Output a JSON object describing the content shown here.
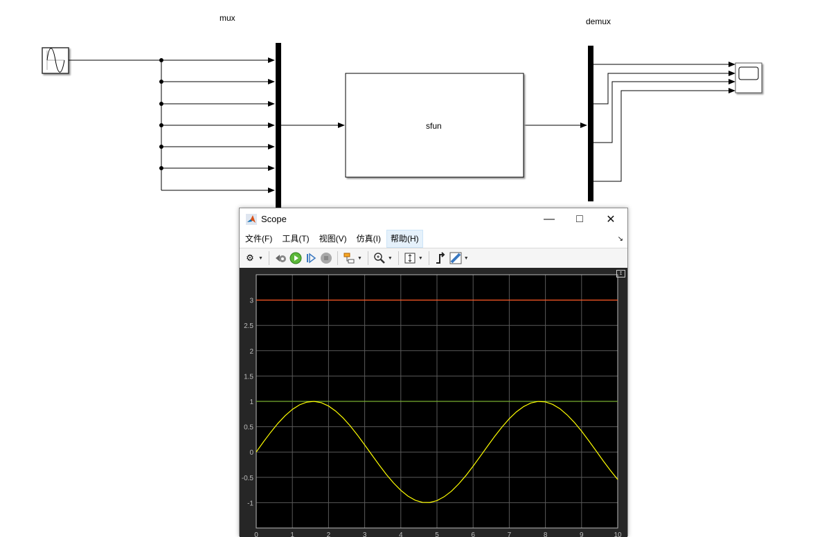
{
  "diagram": {
    "mux_label": "mux",
    "demux_label": "demux",
    "sfun_label": "sfun"
  },
  "scope": {
    "title": "Scope",
    "menu": [
      "文件(F)",
      "工具(T)",
      "视图(V)",
      "仿真(I)",
      "帮助(H)"
    ],
    "active_menu": "帮助(H)",
    "toolbar_icons": [
      "gear-icon",
      "step-back-icon",
      "run-icon",
      "step-forward-icon",
      "stop-icon",
      "highlight-signal-icon",
      "zoom-in-icon",
      "scale-axes-icon",
      "trigger-icon",
      "measurement-icon"
    ]
  },
  "chart_data": {
    "type": "line",
    "xlim": [
      0,
      10
    ],
    "ylim": [
      -1.5,
      3.5
    ],
    "xticks": [
      "0",
      "1",
      "2",
      "3",
      "4",
      "5",
      "6",
      "7",
      "8",
      "9",
      "10"
    ],
    "yticks": [
      "-1",
      "-0.5",
      "0",
      "0.5",
      "1",
      "1.5",
      "2",
      "2.5",
      "3"
    ],
    "grid": true,
    "background": "#000000",
    "x": [
      0,
      0.2,
      0.4,
      0.6,
      0.8,
      1,
      1.2,
      1.4,
      1.6,
      1.8,
      2,
      2.2,
      2.4,
      2.6,
      2.8,
      3,
      3.2,
      3.4,
      3.6,
      3.8,
      4,
      4.2,
      4.4,
      4.6,
      4.8,
      5,
      5.2,
      5.4,
      5.6,
      5.8,
      6,
      6.2,
      6.4,
      6.6,
      6.8,
      7,
      7.2,
      7.4,
      7.6,
      7.8,
      8,
      8.2,
      8.4,
      8.6,
      8.8,
      9,
      9.2,
      9.4,
      9.6,
      9.8,
      10
    ],
    "series": [
      {
        "color": "#ff5722",
        "values": "constant",
        "constant": 3
      },
      {
        "color": "#77ac30",
        "values": "constant",
        "constant": 1
      },
      {
        "color": "#ffff00",
        "values": [
          0,
          0.199,
          0.389,
          0.565,
          0.717,
          0.841,
          0.932,
          0.985,
          1.0,
          0.974,
          0.909,
          0.808,
          0.675,
          0.516,
          0.335,
          0.141,
          -0.058,
          -0.256,
          -0.443,
          -0.612,
          -0.757,
          -0.872,
          -0.952,
          -0.994,
          -0.996,
          -0.959,
          -0.883,
          -0.773,
          -0.631,
          -0.465,
          -0.279,
          -0.083,
          0.117,
          0.312,
          0.494,
          0.657,
          0.794,
          0.899,
          0.968,
          0.999,
          0.989,
          0.941,
          0.855,
          0.734,
          0.585,
          0.412,
          0.223,
          0.025,
          -0.175,
          -0.366,
          -0.544
        ]
      }
    ]
  }
}
